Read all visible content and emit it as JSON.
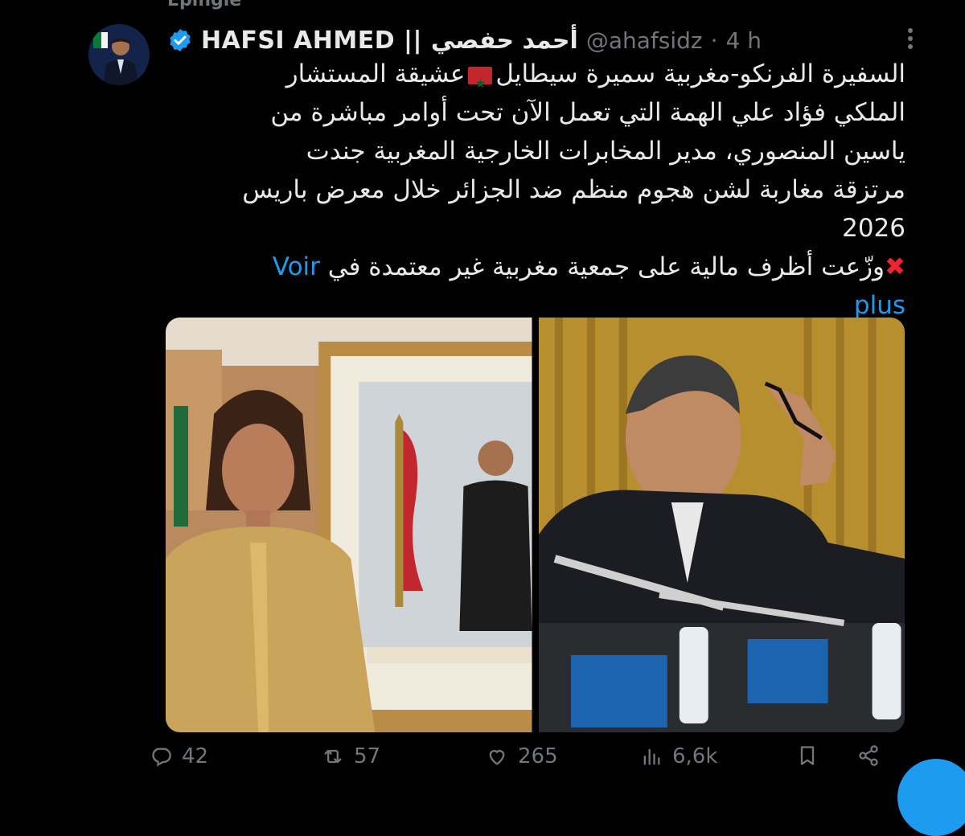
{
  "pinned_label": "Épinglé",
  "author": {
    "display_name": "HAFSI AHMED || أحمد حفصي",
    "handle": "@ahafsidz",
    "separator": "·",
    "time": "4 h"
  },
  "tweet": {
    "lines": [
      "السفيرة الفرنكو-مغربية سميرة سيطايل",
      "عشيقة المستشار",
      "الملكي فؤاد علي الهمة  التي تعمل الآن تحت أوامر مباشرة من",
      "ياسين المنصوري، مدير  المخابرات الخارجية المغربية جندت",
      "مرتزقة مغاربة لشن هجوم منظم ضد الجزائر خلال معرض باريس",
      "2026",
      "وزّعت أظرف مالية على جمعية مغربية غير معتمدة في"
    ],
    "show_more_1": "Voir",
    "show_more_2": "plus"
  },
  "icons": {
    "verified": "verified-badge-icon",
    "more": "more-options-icon",
    "flag": "morocco-flag-emoji",
    "cross": "cross-mark-emoji"
  },
  "actions": {
    "replies": "42",
    "reposts": "57",
    "likes": "265",
    "views": "6,6k"
  },
  "colors": {
    "background": "#000000",
    "text": "#e7e9ea",
    "muted": "#71767b",
    "link": "#1d9bf0",
    "verified": "#1d9bf0"
  }
}
